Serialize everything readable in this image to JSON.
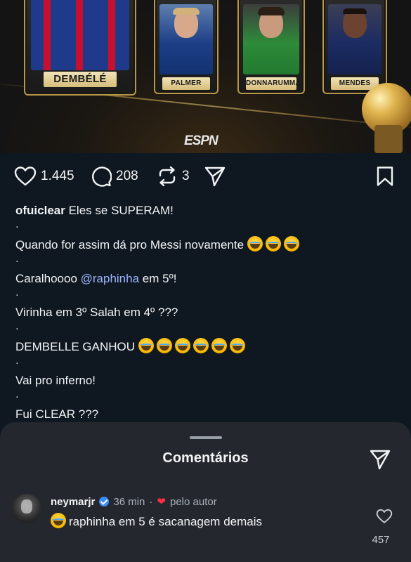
{
  "hero": {
    "players": [
      "DEMBÉLÉ",
      "PALMER",
      "DONNARUMMA",
      "MENDES"
    ],
    "brand": "ESPN"
  },
  "actions": {
    "likes": "1.445",
    "comments": "208",
    "reposts": "3",
    "icons": [
      "heart-icon",
      "comment-icon",
      "repost-icon",
      "share-icon",
      "bookmark-icon"
    ]
  },
  "caption": {
    "user": "ofuiclear",
    "first_line": "Eles se SUPERAM!",
    "dot": ".",
    "line_messi": "Quando for assim dá pro Messi novamente",
    "line_raphinha_pre": "Caralhoooo ",
    "line_raphinha_mention": "@raphinha",
    "line_raphinha_post": " em 5º!",
    "line_virinha": "Virinha em 3º Salah em 4º ???",
    "line_dembelle": "DEMBELLE GANHOU",
    "line_inferno": "Vai pro inferno!",
    "line_clear": "Fui CLEAR ???"
  },
  "comments_sheet": {
    "title": "Comentários",
    "comment": {
      "user": "neymarjr",
      "time": "36 min",
      "separator": "·",
      "author_badge": "pelo autor",
      "text": "raphinha em 5 é sacanagem demais",
      "likes": "457"
    }
  },
  "colors": {
    "background": "#0f1720",
    "sheet": "#24282e",
    "mention": "#9bb4ff",
    "verified": "#3b8cf6",
    "heart_red": "#ff3040"
  }
}
